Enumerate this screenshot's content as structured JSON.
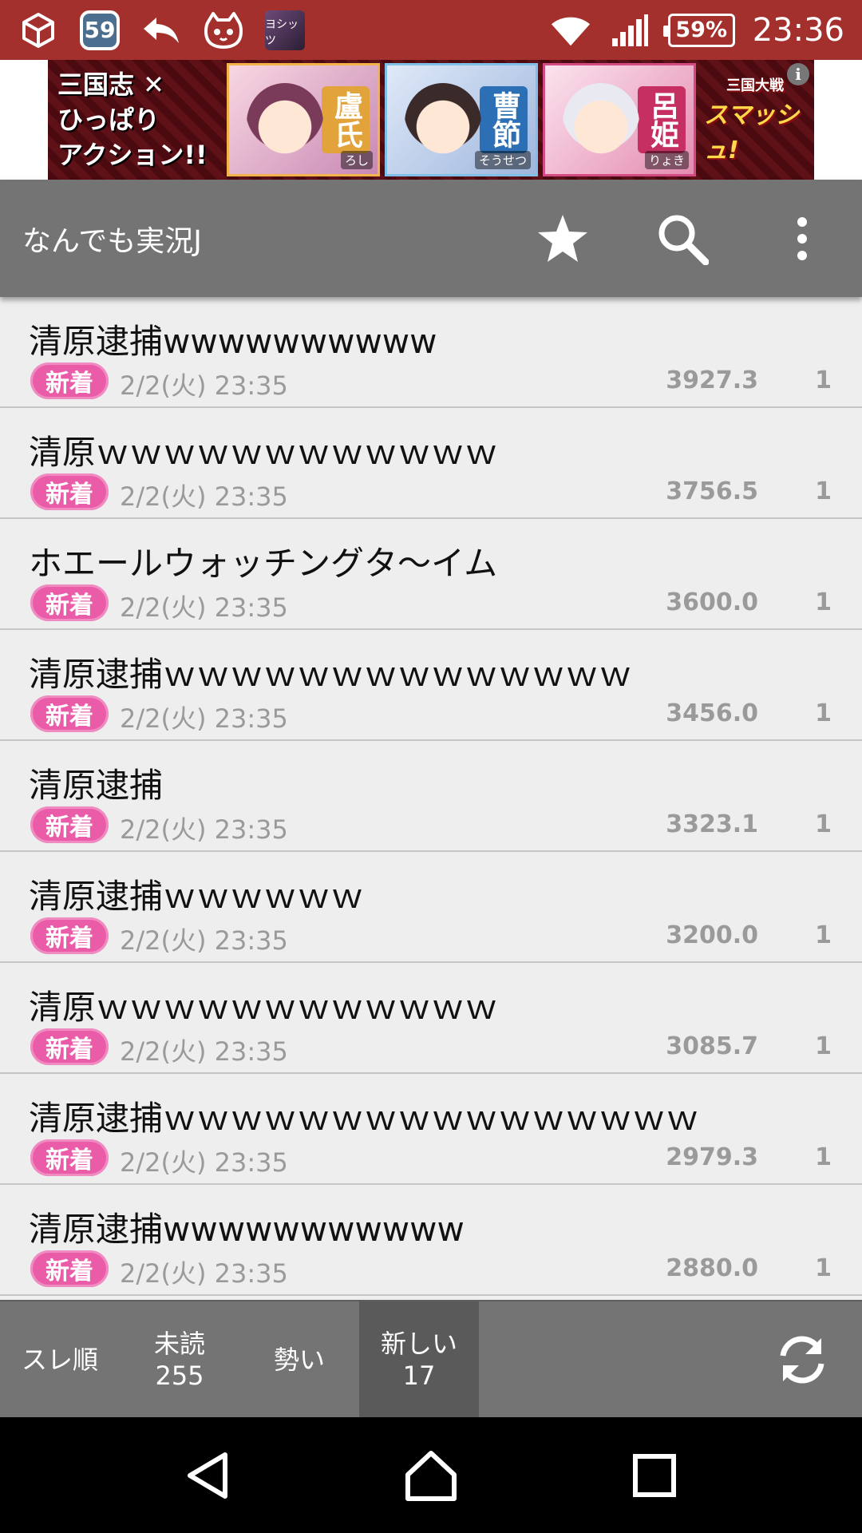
{
  "status_bar": {
    "notification_count": "59",
    "app_thumb_label": "ヨシッツ",
    "battery": "59%",
    "time": "23:36"
  },
  "ad": {
    "title_lines": [
      "三国志 ✕",
      "ひっぱり",
      "アクション!!"
    ],
    "characters": [
      {
        "name": "盧氏",
        "reading": "ろし"
      },
      {
        "name": "曹節",
        "reading": "そうせつ"
      },
      {
        "name": "呂姫",
        "reading": "りょき"
      }
    ],
    "logo_line1": "三国大戦",
    "logo_line2": "スマッシュ!",
    "info": "i"
  },
  "toolbar": {
    "title": "なんでも実況J",
    "icons": [
      "star-icon",
      "search-icon",
      "more-vert-icon"
    ]
  },
  "threads": [
    {
      "title": "清原逮捕wwwwwwwwww",
      "badge": "新着",
      "date": "2/2(火) 23:35",
      "speed": "3927.3",
      "count": "1"
    },
    {
      "title": "清原ｗｗｗｗｗｗｗｗｗｗｗｗ",
      "badge": "新着",
      "date": "2/2(火) 23:35",
      "speed": "3756.5",
      "count": "1"
    },
    {
      "title": "ホエールウォッチングタ～イム",
      "badge": "新着",
      "date": "2/2(火) 23:35",
      "speed": "3600.0",
      "count": "1"
    },
    {
      "title": "清原逮捕ｗｗｗｗｗｗｗｗｗｗｗｗｗｗ",
      "badge": "新着",
      "date": "2/2(火) 23:35",
      "speed": "3456.0",
      "count": "1"
    },
    {
      "title": "清原逮捕",
      "badge": "新着",
      "date": "2/2(火) 23:35",
      "speed": "3323.1",
      "count": "1"
    },
    {
      "title": "清原逮捕ｗｗｗｗｗｗ",
      "badge": "新着",
      "date": "2/2(火) 23:35",
      "speed": "3200.0",
      "count": "1"
    },
    {
      "title": "清原ｗｗｗｗｗｗｗｗｗｗｗｗ",
      "badge": "新着",
      "date": "2/2(火) 23:35",
      "speed": "3085.7",
      "count": "1"
    },
    {
      "title": "清原逮捕ｗｗｗｗｗｗｗｗｗｗｗｗｗｗｗｗ",
      "badge": "新着",
      "date": "2/2(火) 23:35",
      "speed": "2979.3",
      "count": "1"
    },
    {
      "title": "清原逮捕wwwwwwwwwww",
      "badge": "新着",
      "date": "2/2(火) 23:35",
      "speed": "2880.0",
      "count": "1"
    }
  ],
  "bottom_tabs": [
    {
      "label": "スレ順",
      "sub": ""
    },
    {
      "label": "未読",
      "sub": "255"
    },
    {
      "label": "勢い",
      "sub": ""
    },
    {
      "label": "新しい",
      "sub": "17",
      "active": true
    }
  ],
  "colors": {
    "status_bar": "#a3302c",
    "toolbar": "#747474",
    "badge": "#ea5ba8",
    "list_bg": "#eeeeee"
  }
}
